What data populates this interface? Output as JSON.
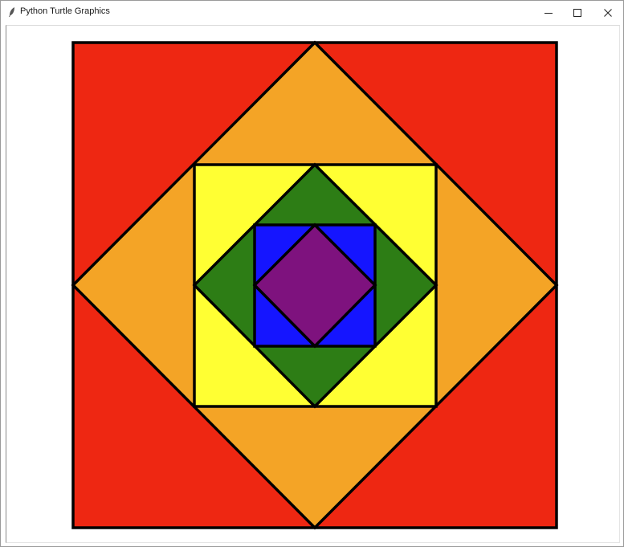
{
  "window": {
    "title": "Python Turtle Graphics",
    "app_icon": "feather-icon",
    "controls": {
      "minimize_icon": "minimize-icon",
      "maximize_icon": "maximize-icon",
      "close_icon": "close-icon"
    }
  },
  "drawing": {
    "outline_color": "#000000",
    "colors": {
      "outer_square": "#ee2712",
      "diamond_1": "#f4a426",
      "square_2": "#ffff33",
      "diamond_2": "#2d7d15",
      "square_3": "#1515ff",
      "diamond_3": "#7e127e"
    }
  }
}
